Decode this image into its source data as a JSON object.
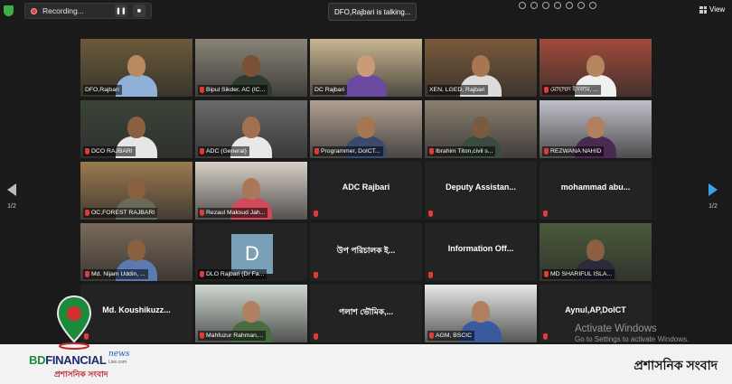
{
  "topbar": {
    "recording_label": "Recording...",
    "pause_icon": "pause-icon",
    "stop_icon": "stop-icon",
    "talking_indicator": "DFO,Rajbari is talking...",
    "view_label": "View"
  },
  "tiles": [
    {
      "name": "DFO,Rajbari",
      "muted": false,
      "active": true,
      "bg": "#6b5a3a",
      "skin": "#b98a60",
      "shirt": "#8fb1d8"
    },
    {
      "name": "Bipul Sikder, AC (IC...",
      "muted": true,
      "bg": "#8a8478",
      "skin": "#7a5233",
      "shirt": "#2e3a2e"
    },
    {
      "name": "DC Rajbari",
      "muted": false,
      "bg": "#c8b690",
      "skin": "#c99b78",
      "shirt": "#6a4aa0"
    },
    {
      "name": "XEN, LGED, Rajbari",
      "muted": false,
      "bg": "#7a5a3a",
      "skin": "#a87653",
      "shirt": "#dcdcdc"
    },
    {
      "name": "মোহাম্মদ ইসলাম, ...",
      "muted": true,
      "bg": "#a04a3a",
      "skin": "#b58560",
      "shirt": "#f0f0f0"
    },
    {
      "name": "DCO RAJBARI",
      "muted": true,
      "bg": "#3c4438",
      "skin": "#8a6040",
      "shirt": "#e6e6e6"
    },
    {
      "name": "ADC (General)",
      "muted": true,
      "bg": "#6a6a6a",
      "skin": "#a07050",
      "shirt": "#e8e8e8"
    },
    {
      "name": "Programmer, DoICT...",
      "muted": true,
      "bg": "#b0a090",
      "skin": "#a57652",
      "shirt": "#3a4a6a"
    },
    {
      "name": "Ibrahim Titon,civil s...",
      "muted": true,
      "bg": "#8a8070",
      "skin": "#7a5a40",
      "shirt": "#3a4a40"
    },
    {
      "name": "REZWANA NAHID",
      "muted": true,
      "bg": "#c0c0c8",
      "skin": "#b08060",
      "shirt": "#4a2a50"
    },
    {
      "name": "OC,FOREST RAJBARI",
      "muted": true,
      "bg": "#9a7a50",
      "skin": "#8a6040",
      "shirt": "#6a6a5a"
    },
    {
      "name": "Rezaul Maksud Jah...",
      "muted": true,
      "bg": "#d8d0c8",
      "skin": "#a87858",
      "shirt": "#d24a5a"
    },
    {
      "text_name": "ADC Rajbari",
      "muted": true
    },
    {
      "text_name": "Deputy Assistan...",
      "muted": true
    },
    {
      "text_name": "mohammad abu...",
      "muted": true
    },
    {
      "name": "Md. Nijam Uddin, ...",
      "muted": true,
      "bg": "#7a6a5a",
      "skin": "#8a6040",
      "shirt": "#5a7ab0"
    },
    {
      "name": "DLO Rajbari (Dr Fa...",
      "muted": true,
      "avatar": "D"
    },
    {
      "text_name": "উপ পরিচালক ই...",
      "muted": true
    },
    {
      "text_name": "Information Off...",
      "muted": true
    },
    {
      "name": "MD SHARIFUL ISLA...",
      "muted": true,
      "bg": "#4a5a3a",
      "skin": "#8a6040",
      "shirt": "#2a2a3a"
    },
    {
      "text_name": "Md. Koushikuzz...",
      "muted": true
    },
    {
      "name": "Mahfuzur Rahman,...",
      "muted": true,
      "bg": "#cfd8d0",
      "skin": "#b08060",
      "shirt": "#4a6a40"
    },
    {
      "text_name": "পলাশ ভৌমিক,...",
      "muted": true
    },
    {
      "name": "AGM, BSCIC",
      "muted": true,
      "bg": "#e8e8e8",
      "skin": "#b08060",
      "shirt": "#3a5aa0"
    },
    {
      "text_name": "Aynul,AP,DoICT",
      "muted": true
    }
  ],
  "nav": {
    "left_page": "1/2",
    "right_page": "1/2"
  },
  "watermark": {
    "line1": "Activate Windows",
    "line2": "Go to Settings to activate Windows."
  },
  "banner": {
    "brand_part1": "BD",
    "brand_part2": "FINANCIAL",
    "brand_news": "news",
    "brand_domain": "Live.com",
    "brand_tagline": "প্রশাসনিক সংবাদ",
    "right_title": "প্রশাসনিক সংবাদ",
    "pin_color": "#1b8a3a",
    "pin_dot": "#d32f2f"
  }
}
